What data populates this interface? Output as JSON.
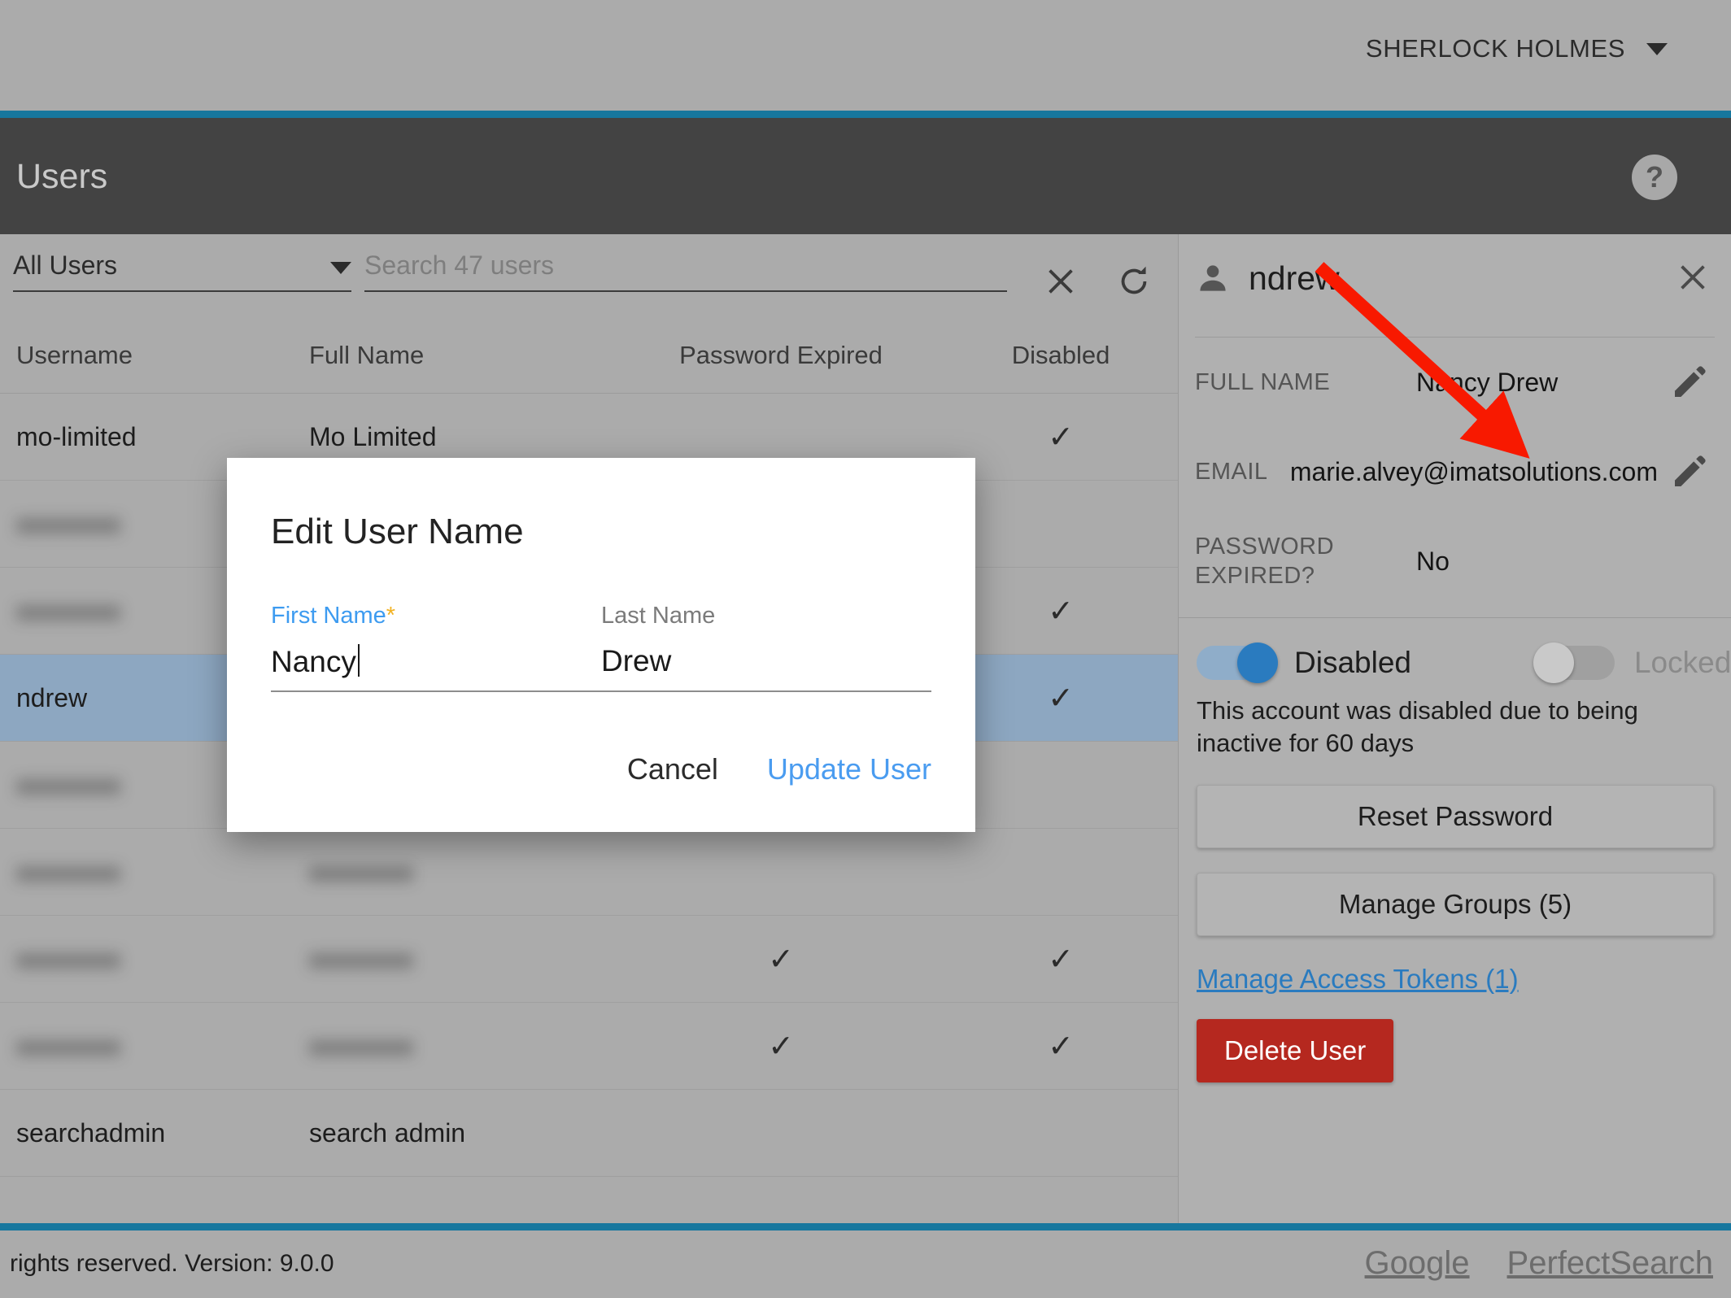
{
  "topbar": {
    "user_name": "SHERLOCK HOLMES",
    "caret_icon": "chevron-down-icon"
  },
  "header": {
    "title": "Users",
    "help_label": "?"
  },
  "toolbar": {
    "filter_value": "All Users",
    "filter_options": [
      "All Users"
    ],
    "search_placeholder": "Search 47 users",
    "search_value": "",
    "clear_icon": "close-icon",
    "refresh_icon": "refresh-icon"
  },
  "table": {
    "columns": [
      "Username",
      "Full Name",
      "Password Expired",
      "Disabled"
    ],
    "rows": [
      {
        "username": "mo-limited",
        "fullname": "Mo Limited",
        "password_expired": "",
        "disabled": "✓",
        "blurred": false,
        "selected": false
      },
      {
        "username": "",
        "fullname": "",
        "password_expired": "",
        "disabled": "",
        "blurred": true,
        "selected": false
      },
      {
        "username": "",
        "fullname": "",
        "password_expired": "",
        "disabled": "✓",
        "blurred": true,
        "selected": false
      },
      {
        "username": "ndrew",
        "fullname": "",
        "password_expired": "",
        "disabled": "✓",
        "blurred": false,
        "selected": true
      },
      {
        "username": "",
        "fullname": "",
        "password_expired": "",
        "disabled": "",
        "blurred": true,
        "selected": false
      },
      {
        "username": "",
        "fullname": "",
        "password_expired": "",
        "disabled": "",
        "blurred": true,
        "selected": false
      },
      {
        "username": "",
        "fullname": "",
        "password_expired": "✓",
        "disabled": "✓",
        "blurred": true,
        "selected": false
      },
      {
        "username": "",
        "fullname": "",
        "password_expired": "✓",
        "disabled": "✓",
        "blurred": true,
        "selected": false
      },
      {
        "username": "searchadmin",
        "fullname": "search admin",
        "password_expired": "",
        "disabled": "",
        "blurred": false,
        "selected": false
      }
    ]
  },
  "details": {
    "avatar_icon": "person-icon",
    "username": "ndrew",
    "close_icon": "close-icon",
    "fields": [
      {
        "label": "FULL NAME",
        "value": "Nancy Drew",
        "edit_icon": "pencil-icon"
      },
      {
        "label": "EMAIL",
        "value": "marie.alvey@imatsolutions.com",
        "edit_icon": "pencil-icon"
      },
      {
        "label": "PASSWORD EXPIRED?",
        "value": "No",
        "edit_icon": ""
      }
    ],
    "toggle_disabled_label": "Disabled",
    "toggle_disabled_on": true,
    "toggle_locked_label": "Locked",
    "toggle_locked_on": false,
    "account_note": "This account was disabled due to being inactive for 60 days",
    "reset_password_label": "Reset Password",
    "manage_groups_label": "Manage Groups (5)",
    "manage_tokens_label": "Manage Access Tokens (1)",
    "delete_user_label": "Delete User"
  },
  "modal": {
    "title": "Edit User Name",
    "first_name_label": "First Name",
    "first_name_required_marker": "*",
    "first_name_value": "Nancy",
    "last_name_label": "Last Name",
    "last_name_value": "Drew",
    "cancel_label": "Cancel",
    "confirm_label": "Update User"
  },
  "footer": {
    "copyright": "rights reserved. Version: 9.0.0",
    "links": [
      "Google",
      "PerfectSearch"
    ]
  },
  "colors": {
    "accent_teal": "#17779e",
    "header_dark": "#434343",
    "page_bg": "#ababab",
    "selected_row": "#8da7c1",
    "link_blue": "#2a7bbf",
    "required_blue": "#3d9bf0",
    "required_star": "#f2b223",
    "danger_red": "#b5281f",
    "toggle_on": "#2a7bbf",
    "annotation_arrow": "#f81900"
  }
}
